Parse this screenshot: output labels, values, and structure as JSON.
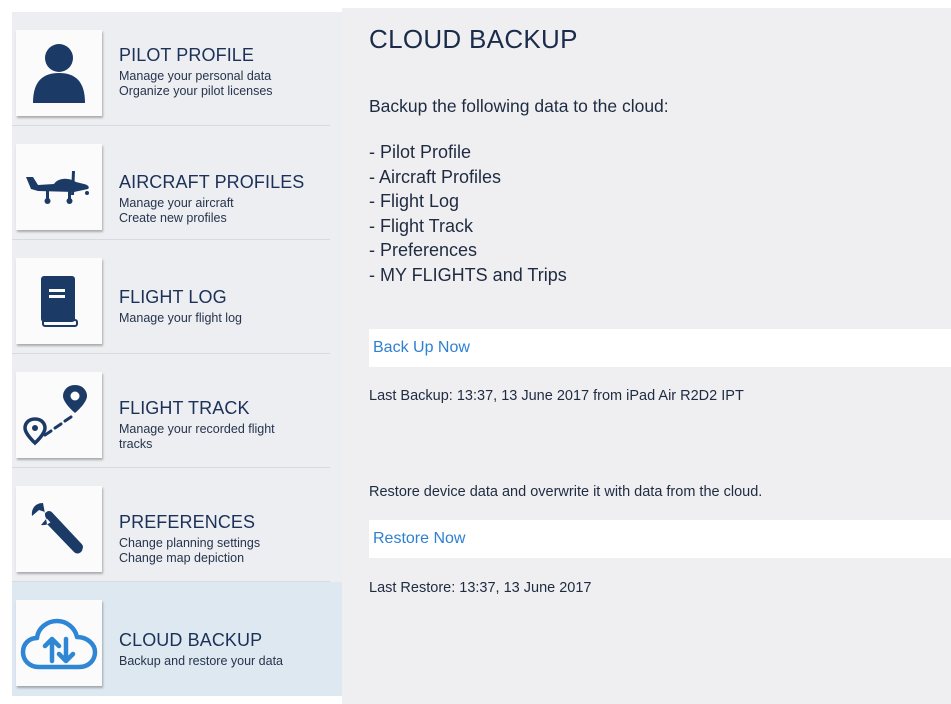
{
  "sidebar": {
    "items": [
      {
        "title": "PILOT PROFILE",
        "lines": [
          "Manage your personal data",
          "Organize your pilot licenses"
        ],
        "icon": "person-icon",
        "active": false
      },
      {
        "title": "AIRCRAFT PROFILES",
        "lines": [
          "Manage your aircraft",
          "Create new profiles"
        ],
        "icon": "airplane-icon",
        "active": false
      },
      {
        "title": "FLIGHT LOG",
        "lines": [
          "Manage your flight log"
        ],
        "icon": "logbook-icon",
        "active": false
      },
      {
        "title": "FLIGHT TRACK",
        "lines": [
          "Manage your recorded flight",
          "tracks"
        ],
        "icon": "route-pins-icon",
        "active": false
      },
      {
        "title": "PREFERENCES",
        "lines": [
          "Change planning settings",
          "Change map depiction"
        ],
        "icon": "wrench-icon",
        "active": false
      },
      {
        "title": "CLOUD BACKUP",
        "lines": [
          "Backup and restore your data"
        ],
        "icon": "cloud-sync-icon",
        "active": true
      }
    ]
  },
  "main": {
    "title": "CLOUD BACKUP",
    "intro": "Backup the following data to the cloud:",
    "data_items": [
      "- Pilot Profile",
      "- Aircraft Profiles",
      "- Flight Log",
      "- Flight Track",
      "- Preferences",
      "- MY FLIGHTS and Trips"
    ],
    "backup_button": "Back Up Now",
    "last_backup": "Last Backup: 13:37, 13 June 2017 from iPad Air R2D2 IPT",
    "restore_description": "Restore device data and overwrite it with data from the cloud.",
    "restore_button": "Restore Now",
    "last_restore": "Last Restore: 13:37, 13 June 2017"
  },
  "colors": {
    "icon_navy": "#1c3a66",
    "active_blue": "#2e86d4",
    "link_blue": "#2f80d2",
    "active_background": "#dde8f1"
  }
}
